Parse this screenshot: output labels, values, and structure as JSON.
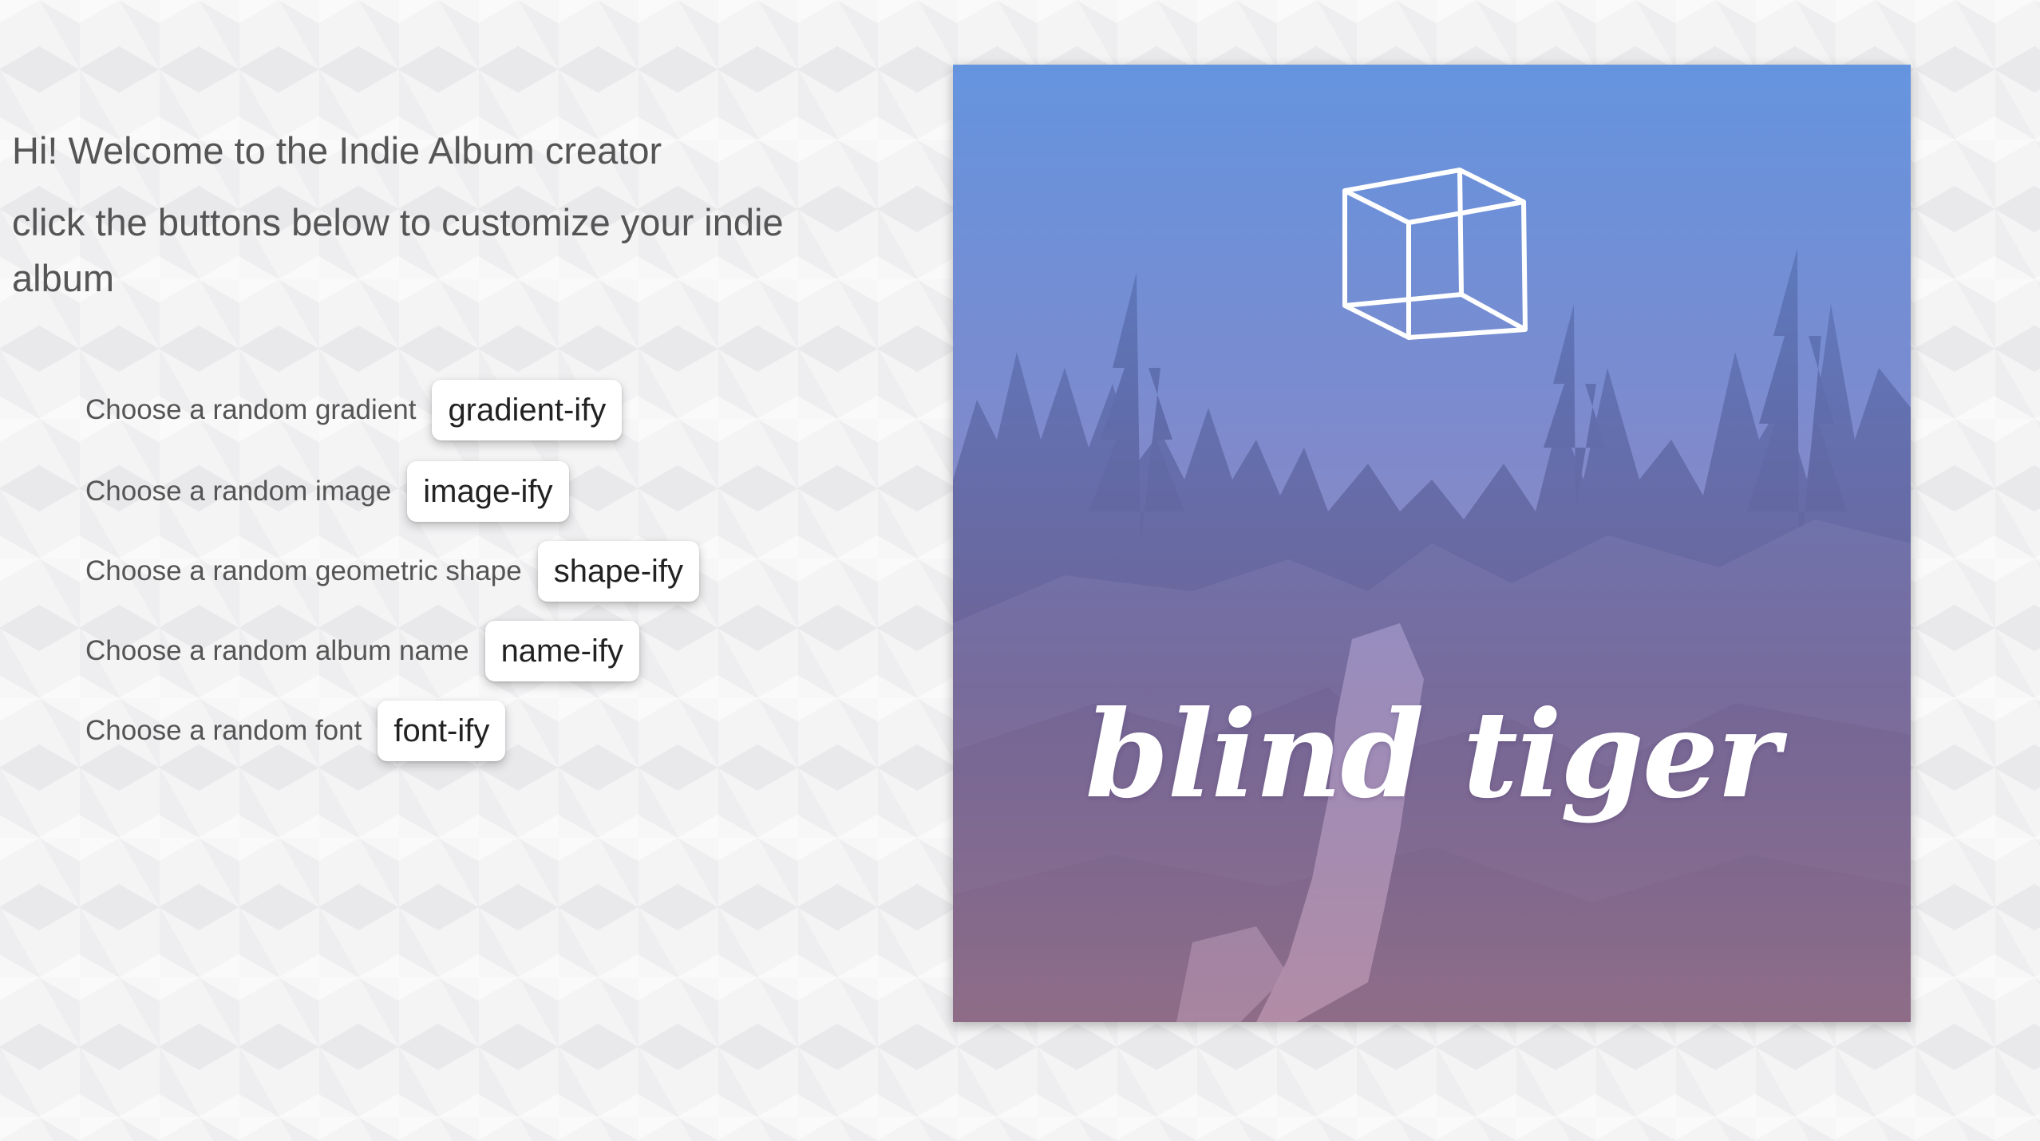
{
  "intro": {
    "welcome": "Hi! Welcome to the Indie Album creator",
    "instructions": "click the buttons below to customize your indie album"
  },
  "controls": [
    {
      "label": "Choose a random gradient",
      "button": "gradient-ify"
    },
    {
      "label": "Choose a random image",
      "button": "image-ify"
    },
    {
      "label": "Choose a random geometric shape",
      "button": "shape-ify"
    },
    {
      "label": "Choose a random album name",
      "button": "name-ify"
    },
    {
      "label": "Choose a random font",
      "button": "font-ify"
    }
  ],
  "album": {
    "name": "blind tiger",
    "shape": "cube-icon",
    "image": "forest waterfall landscape",
    "gradient": {
      "top": "#6092de",
      "middle": "#7d7cc0",
      "bottom": "#a97a98"
    }
  }
}
